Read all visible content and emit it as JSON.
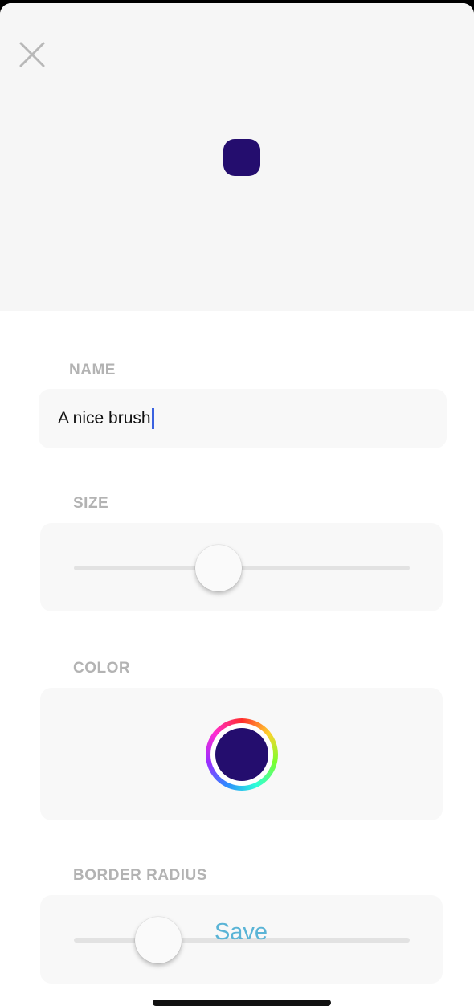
{
  "colors": {
    "brush_color": "#240d6e",
    "accent": "#5ab4d6",
    "label_gray": "#b3b3b3"
  },
  "preview": {
    "close_icon": "close-icon"
  },
  "name_section": {
    "label": "NAME",
    "value": "A nice brush"
  },
  "size_section": {
    "label": "SIZE",
    "value_fraction": 0.43
  },
  "color_section": {
    "label": "COLOR"
  },
  "border_radius_section": {
    "label": "BORDER RADIUS",
    "value_fraction": 0.25
  },
  "save_button": {
    "label": "Save"
  }
}
